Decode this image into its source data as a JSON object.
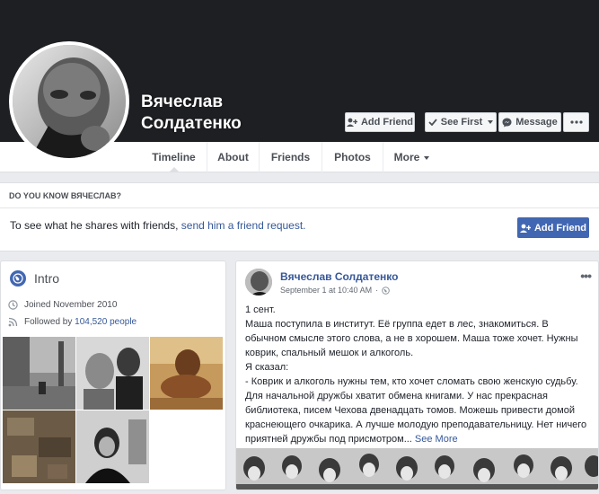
{
  "profile": {
    "name_line1": "Вячеслав",
    "name_line2": "Солдатенко"
  },
  "cover_actions": {
    "add_friend": "Add Friend",
    "see_first": "See First",
    "message": "Message"
  },
  "tabs": [
    "Timeline",
    "About",
    "Friends",
    "Photos",
    "More"
  ],
  "know_box": {
    "title": "Do you know Вячеслав?",
    "text": "To see what he shares with friends, ",
    "link": "send him a friend request.",
    "button": "Add Friend"
  },
  "intro": {
    "title": "Intro",
    "joined": "Joined November 2010",
    "followed_prefix": "Followed by ",
    "followers": "104,520 people",
    "photos_count": 5
  },
  "post": {
    "author": "Вячеслав Солдатенко",
    "date": "September 1 at 10:40 AM",
    "audience": "globe-icon",
    "text": "1 сент.\nМаша поступила в институт. Её группа едет в лес, знакомиться. В обычном смысле этого слова, а не в хорошем. Маша тоже хочет. Нужны коврик, спальный мешок и алкоголь.\nЯ сказал:\n- Коврик и алкоголь нужны тем, кто хочет сломать свою женскую судьбу. Для начальной дружбы хватит обмена книгами. У нас прекрасная библиотека, писем Чехова двенадцать томов. Можешь привести домой краснеющего очкарика. А лучше молодую преподавательницу. Нет ничего приятней дружбы под присмотром... ",
    "see_more": "See More"
  },
  "colors": {
    "cover": "#1e1f23",
    "link": "#365899",
    "primary_button": "#4267b2",
    "page_bg": "#e9ebee"
  }
}
